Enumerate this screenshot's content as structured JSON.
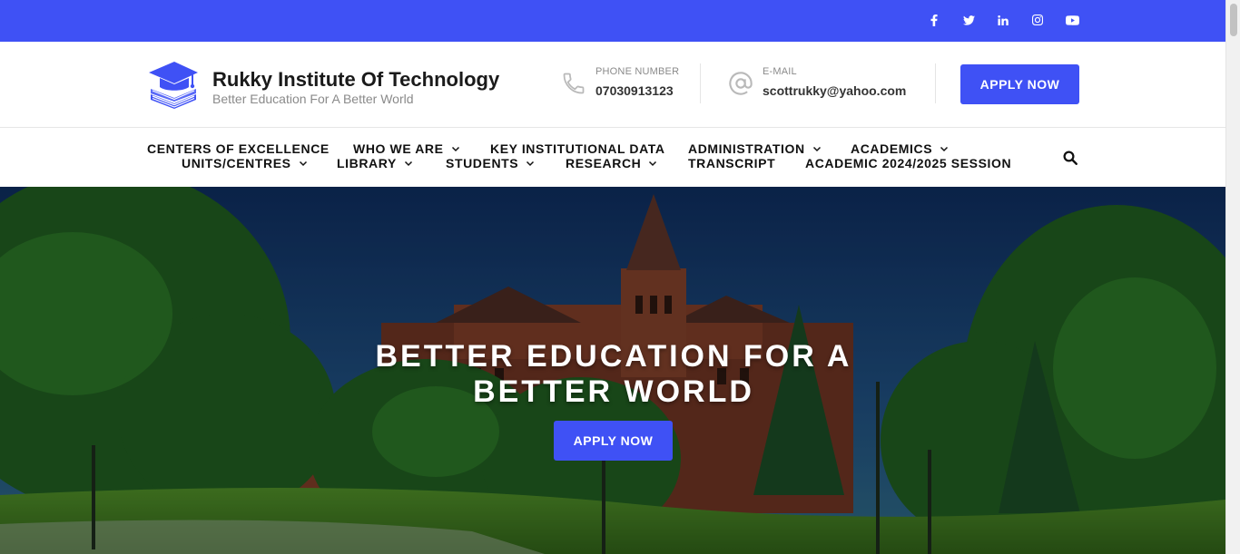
{
  "colors": {
    "brand": "#3f51f5",
    "text_dark": "#111111",
    "text_muted": "#8a8a8a"
  },
  "social": [
    {
      "name": "facebook-icon"
    },
    {
      "name": "twitter-icon"
    },
    {
      "name": "linkedin-icon"
    },
    {
      "name": "instagram-icon"
    },
    {
      "name": "youtube-icon"
    }
  ],
  "brand": {
    "title": "Rukky Institute Of Technology",
    "tagline": "Better Education For A Better World",
    "logo_icon": "graduation-cap-book-icon"
  },
  "contact": {
    "phone": {
      "label": "PHONE NUMBER",
      "value": "07030913123",
      "icon": "phone-icon"
    },
    "email": {
      "label": "E-MAIL",
      "value": "scottrukky@yahoo.com",
      "icon": "at-sign-icon"
    }
  },
  "header": {
    "apply_label": "APPLY NOW"
  },
  "nav": {
    "row1": [
      {
        "label": "CENTERS OF EXCELLENCE",
        "dropdown": false
      },
      {
        "label": "WHO WE ARE",
        "dropdown": true
      },
      {
        "label": "KEY INSTITUTIONAL DATA",
        "dropdown": false
      },
      {
        "label": "ADMINISTRATION",
        "dropdown": true
      },
      {
        "label": "ACADEMICS",
        "dropdown": true
      }
    ],
    "row2": [
      {
        "label": "UNITS/CENTRES",
        "dropdown": true
      },
      {
        "label": "LIBRARY",
        "dropdown": true
      },
      {
        "label": "STUDENTS",
        "dropdown": true
      },
      {
        "label": "RESEARCH",
        "dropdown": true
      },
      {
        "label": "TRANSCRIPT",
        "dropdown": false
      },
      {
        "label": "ACADEMIC 2024/2025 SESSION",
        "dropdown": false
      }
    ],
    "search_icon": "search-icon"
  },
  "hero": {
    "title": "BETTER EDUCATION FOR A BETTER WORLD",
    "apply_label": "APPLY NOW"
  }
}
